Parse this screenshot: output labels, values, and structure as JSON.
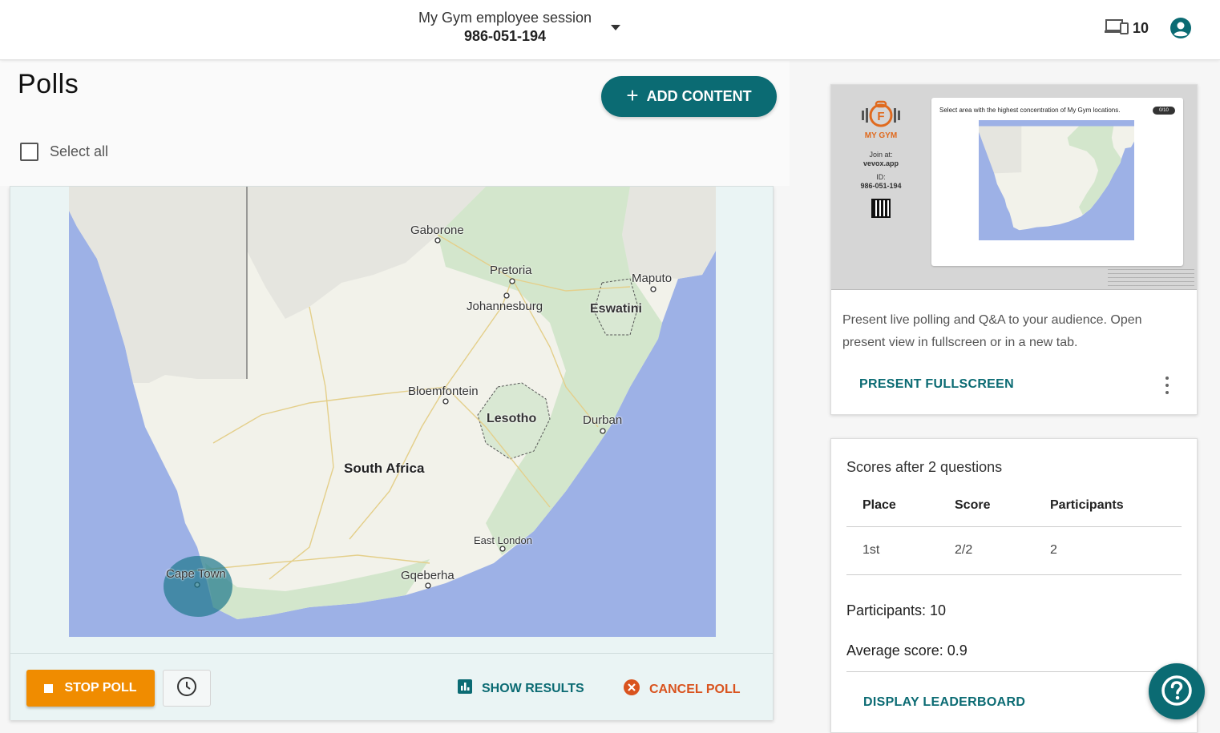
{
  "header": {
    "session_name": "My Gym employee session",
    "session_code": "986-051-194",
    "device_count": "10"
  },
  "polls": {
    "title": "Polls",
    "add_content_label": "ADD CONTENT",
    "select_all_label": "Select all"
  },
  "map": {
    "labels": {
      "gaborone": "Gaborone",
      "pretoria": "Pretoria",
      "maputo": "Maputo",
      "johannesburg": "Johannesburg",
      "eswatini": "Eswatini",
      "bloemfontein": "Bloemfontein",
      "lesotho": "Lesotho",
      "durban": "Durban",
      "south_africa": "South Africa",
      "east_london": "East London",
      "cape_town": "Cape Town",
      "gqeberha": "Gqeberha"
    },
    "colors": {
      "water": "#9db1e6",
      "land": "#f2f2ea",
      "green": "#d3e6cc",
      "answer": "#1e788c"
    }
  },
  "poll_actions": {
    "stop_poll": "STOP POLL",
    "show_results": "SHOW RESULTS",
    "cancel_poll": "CANCEL POLL"
  },
  "present": {
    "preview": {
      "brand": "MY GYM",
      "join_label": "Join at:",
      "join_url": "vevox.app",
      "id_label": "ID:",
      "id_value": "986-051-194",
      "question": "Select area with the highest concentration of My Gym locations.",
      "badge": "0/10"
    },
    "description": "Present live polling and Q&A to your audience. Open present view in fullscreen or in a new tab.",
    "fullscreen_label": "PRESENT FULLSCREEN"
  },
  "scores": {
    "title": "Scores after 2 questions",
    "columns": [
      "Place",
      "Score",
      "Participants"
    ],
    "rows": [
      [
        "1st",
        "2/2",
        "2"
      ]
    ],
    "participants": "Participants: 10",
    "average": "Average score: 0.9",
    "leaderboard_label": "DISPLAY LEADERBOARD"
  },
  "colors": {
    "primary": "#0b6b73",
    "stop": "#f08c00",
    "cancel": "#d9531e"
  }
}
